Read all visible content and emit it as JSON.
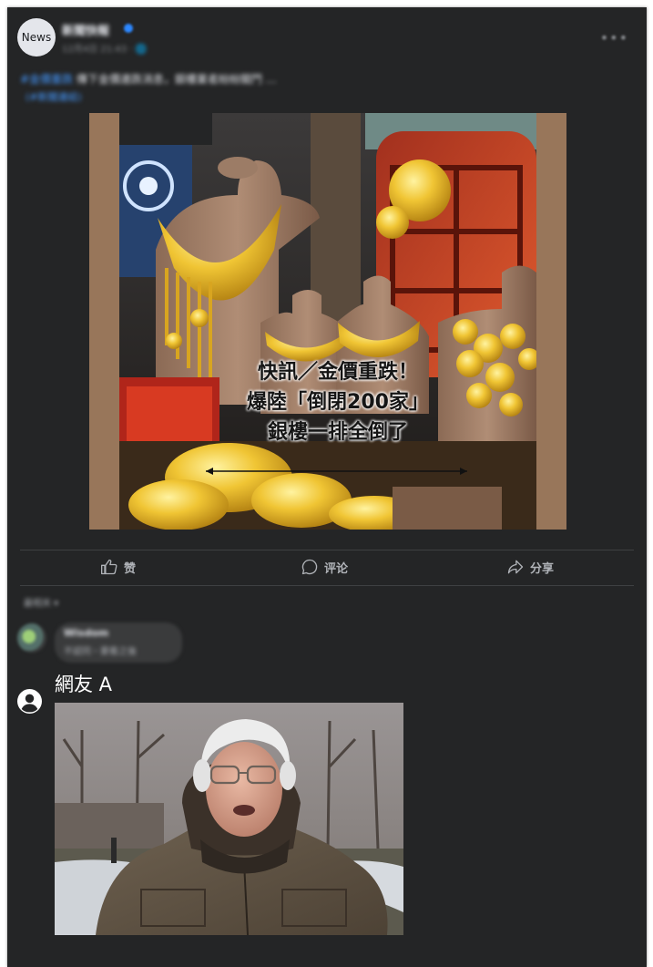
{
  "post": {
    "avatar_text": "News",
    "page_name": "新聞快報",
    "timestamp": "12月4日 21:43 · 🌐",
    "caption_tag": "#金價重跌",
    "caption_text": "傳下金價連跌消息，銀樓業者紛紛關門 …",
    "caption_link": "(#新聞連結)",
    "more_icon": "more-dots-icon",
    "headline_lines": [
      "快訊／金價重跌！",
      "爆陸「倒閉200家」",
      "銀樓一排全倒了"
    ]
  },
  "actions": {
    "like_label": "赞",
    "comment_label": "评论",
    "share_label": "分享",
    "like_icon": "thumbs-up-icon",
    "comment_icon": "comment-bubble-icon",
    "share_icon": "share-arrow-icon"
  },
  "comments": {
    "sort_label": "最相关 ▾",
    "first": {
      "name": "Wisdom",
      "text": "不認同・要看之後"
    },
    "netizen": {
      "name": "網友 A",
      "icon": "user-circle-icon"
    }
  },
  "colors": {
    "card_bg": "#242526",
    "text": "#e4e6eb",
    "muted": "#b0b3b8",
    "link": "#4599ff"
  }
}
